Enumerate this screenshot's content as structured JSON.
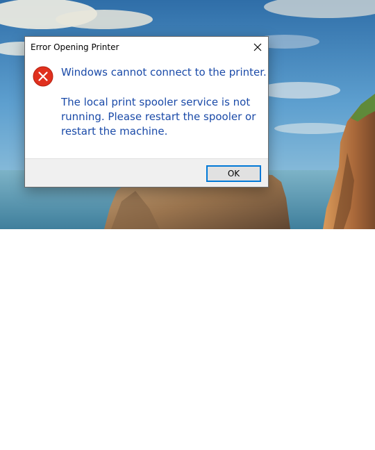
{
  "desktop": {
    "wallpaper_icon": "landscape-wallpaper"
  },
  "dialog": {
    "title": "Error Opening Printer",
    "close_icon": "close-icon",
    "error_icon": "error-icon",
    "main_instruction": "Windows cannot connect to the printer.",
    "detail_line1": "The local print spooler service is not",
    "detail_line2": "running. Please restart the spooler or",
    "detail_line3": "restart the machine.",
    "ok_label": "OK"
  },
  "colors": {
    "message_text": "#1a4aa8",
    "error_red": "#e0301e",
    "button_focus_border": "#0078d7",
    "footer_bg": "#f0f0f0"
  }
}
